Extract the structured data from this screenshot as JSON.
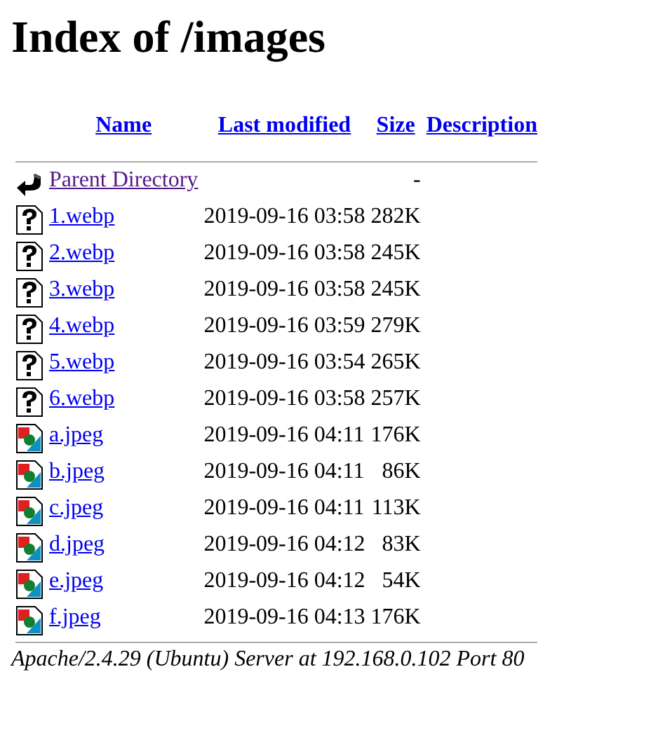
{
  "title": "Index of /images",
  "columns": [
    "Name",
    "Last modified",
    "Size",
    "Description"
  ],
  "rows": [
    {
      "kind": "parent",
      "name": "Parent Directory",
      "visited": true,
      "modified": "",
      "size": "-"
    },
    {
      "kind": "unknown",
      "name": "1.webp",
      "visited": false,
      "modified": "2019-09-16 03:58",
      "size": "282K"
    },
    {
      "kind": "unknown",
      "name": "2.webp",
      "visited": false,
      "modified": "2019-09-16 03:58",
      "size": "245K"
    },
    {
      "kind": "unknown",
      "name": "3.webp",
      "visited": false,
      "modified": "2019-09-16 03:58",
      "size": "245K"
    },
    {
      "kind": "unknown",
      "name": "4.webp",
      "visited": false,
      "modified": "2019-09-16 03:59",
      "size": "279K"
    },
    {
      "kind": "unknown",
      "name": "5.webp",
      "visited": false,
      "modified": "2019-09-16 03:54",
      "size": "265K"
    },
    {
      "kind": "unknown",
      "name": "6.webp",
      "visited": false,
      "modified": "2019-09-16 03:58",
      "size": "257K"
    },
    {
      "kind": "image",
      "name": "a.jpeg",
      "visited": false,
      "modified": "2019-09-16 04:11",
      "size": "176K"
    },
    {
      "kind": "image",
      "name": "b.jpeg",
      "visited": false,
      "modified": "2019-09-16 04:11",
      "size": "86K"
    },
    {
      "kind": "image",
      "name": "c.jpeg",
      "visited": false,
      "modified": "2019-09-16 04:11",
      "size": "113K"
    },
    {
      "kind": "image",
      "name": "d.jpeg",
      "visited": false,
      "modified": "2019-09-16 04:12",
      "size": "83K"
    },
    {
      "kind": "image",
      "name": "e.jpeg",
      "visited": false,
      "modified": "2019-09-16 04:12",
      "size": "54K"
    },
    {
      "kind": "image",
      "name": "f.jpeg",
      "visited": false,
      "modified": "2019-09-16 04:13",
      "size": "176K"
    }
  ],
  "footer": "Apache/2.4.29 (Ubuntu) Server at 192.168.0.102 Port 80"
}
